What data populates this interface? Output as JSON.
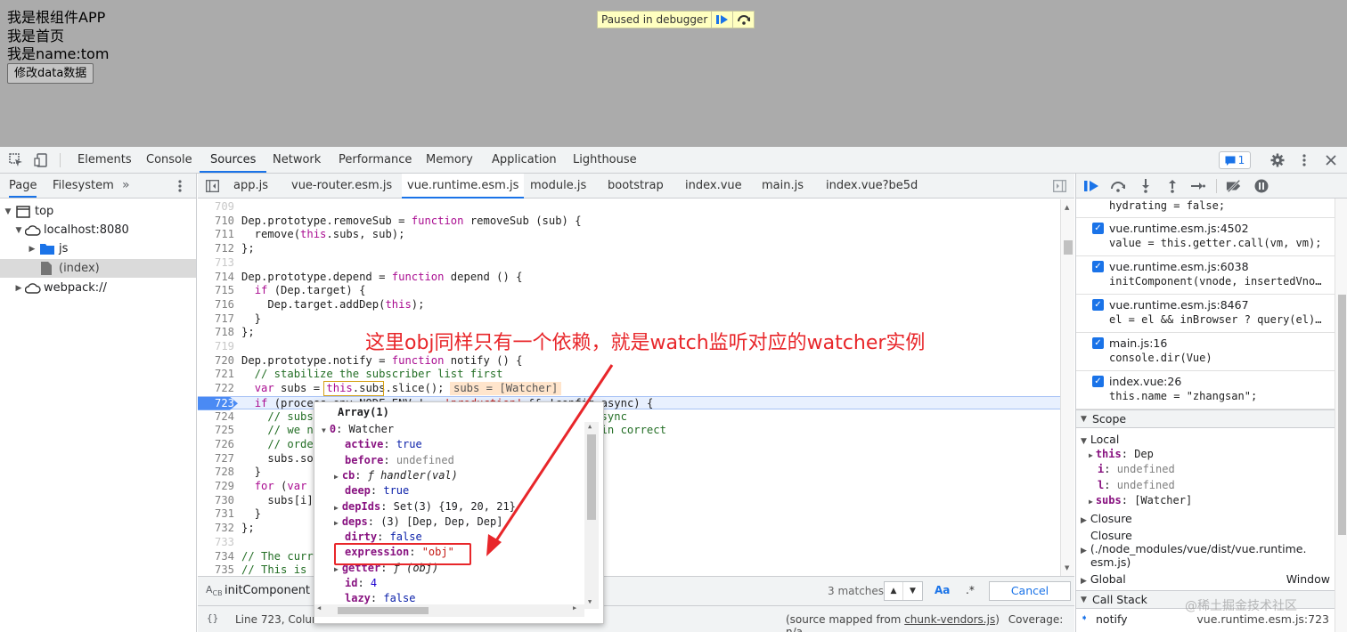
{
  "page": {
    "lines": [
      "我是根组件APP",
      "我是首页",
      "我是name:tom"
    ],
    "button_label": "修改data数据",
    "paused_text": "Paused in debugger"
  },
  "devtools_tabs": [
    "Elements",
    "Console",
    "Sources",
    "Network",
    "Performance",
    "Memory",
    "Application",
    "Lighthouse"
  ],
  "active_tab": "Sources",
  "issues_count": "1",
  "navigator": {
    "tabs": [
      "Page",
      "Filesystem"
    ],
    "tree": [
      {
        "label": "top",
        "depth": 0,
        "icon": "frame-icon",
        "expanded": true
      },
      {
        "label": "localhost:8080",
        "depth": 1,
        "icon": "cloud-icon",
        "expanded": true
      },
      {
        "label": "js",
        "depth": 2,
        "icon": "folder-icon",
        "expanded": false
      },
      {
        "label": "(index)",
        "depth": 2,
        "icon": "file-icon",
        "selected": true
      },
      {
        "label": "webpack://",
        "depth": 0,
        "icon": "cloud-icon",
        "expanded": false
      }
    ]
  },
  "file_tabs": [
    "app.js",
    "vue-router.esm.js",
    "vue.runtime.esm.js",
    "module.js",
    "bootstrap",
    "index.vue",
    "main.js",
    "index.vue?be5d"
  ],
  "active_file": "vue.runtime.esm.js",
  "code_lines": [
    {
      "n": "709",
      "t": ""
    },
    {
      "n": "710",
      "t": "Dep.prototype.removeSub = function removeSub (sub) {"
    },
    {
      "n": "711",
      "t": "  remove(this.subs, sub);"
    },
    {
      "n": "712",
      "t": "};"
    },
    {
      "n": "713",
      "t": ""
    },
    {
      "n": "714",
      "t": "Dep.prototype.depend = function depend () {"
    },
    {
      "n": "715",
      "t": "  if (Dep.target) {"
    },
    {
      "n": "716",
      "t": "    Dep.target.addDep(this);"
    },
    {
      "n": "717",
      "t": "  }"
    },
    {
      "n": "718",
      "t": "};"
    },
    {
      "n": "719",
      "t": ""
    },
    {
      "n": "720",
      "t": "Dep.prototype.notify = function notify () {"
    },
    {
      "n": "721",
      "t": "  // stabilize the subscriber list first"
    },
    {
      "n": "722",
      "t": "  var subs = this.subs.slice();"
    },
    {
      "n": "723",
      "t": "  if (process.env.NODE_ENV !== 'production' && !config.async) {"
    },
    {
      "n": "724",
      "t": "    // subs aren't sorted in scheduler if not running async"
    },
    {
      "n": "725",
      "t": "    // we need to sort them now to make sure they fire in correct"
    },
    {
      "n": "726",
      "t": "    // order"
    },
    {
      "n": "727",
      "t": "    subs.sort(function (a, b) { return a.id - b.id; });"
    },
    {
      "n": "728",
      "t": "  }"
    },
    {
      "n": "729",
      "t": "  for (var i = 0, l = subs.length; i < l; i++) {"
    },
    {
      "n": "730",
      "t": "    subs[i].update();"
    },
    {
      "n": "731",
      "t": "  }"
    },
    {
      "n": "732",
      "t": "};"
    },
    {
      "n": "733",
      "t": ""
    },
    {
      "n": "734",
      "t": "// The current target watcher being evaluated."
    },
    {
      "n": "735",
      "t": "// This is globally unique because only one watcher"
    }
  ],
  "inline_value": "subs = [Watcher]",
  "popover": {
    "title": "Array(1)",
    "rows": [
      {
        "k": "0",
        "v": "Watcher",
        "tri": true,
        "open": true
      },
      {
        "k": "active",
        "v": "true",
        "type": "kw"
      },
      {
        "k": "before",
        "v": "undefined",
        "type": "grey"
      },
      {
        "k": "cb",
        "v": "ƒ handler(val)",
        "tri": true,
        "type": "fn"
      },
      {
        "k": "deep",
        "v": "true",
        "type": "kw"
      },
      {
        "k": "depIds",
        "v": "Set(3) {19, 20, 21}",
        "tri": true
      },
      {
        "k": "deps",
        "v": "(3) [Dep, Dep, Dep]",
        "tri": true
      },
      {
        "k": "dirty",
        "v": "false",
        "type": "kw"
      },
      {
        "k": "expression",
        "v": "\"obj\"",
        "type": "str"
      },
      {
        "k": "getter",
        "v": "ƒ (obj)",
        "tri": true,
        "type": "fn"
      },
      {
        "k": "id",
        "v": "4",
        "type": "num"
      },
      {
        "k": "lazy",
        "v": "false",
        "type": "kw"
      }
    ]
  },
  "search": {
    "value": "initComponent",
    "matches": "3 matches",
    "match_case": "Aa",
    "regex": ".*",
    "cancel": "Cancel"
  },
  "status": {
    "position": "Line 723, Colum",
    "source_mapped_prefix": "(source mapped from ",
    "source_mapped_link": "chunk-vendors.js",
    "source_mapped_suffix": ")",
    "coverage": "Coverage: n/a"
  },
  "breakpoints": [
    {
      "file": "",
      "code": "hydrating = false;"
    },
    {
      "file": "vue.runtime.esm.js:4502",
      "code": "value = this.getter.call(vm, vm);"
    },
    {
      "file": "vue.runtime.esm.js:6038",
      "code": "initComponent(vnode, insertedVno…"
    },
    {
      "file": "vue.runtime.esm.js:8467",
      "code": "el = el && inBrowser ? query(el)…"
    },
    {
      "file": "main.js:16",
      "code": "console.dir(Vue)"
    },
    {
      "file": "index.vue:26",
      "code": "this.name = \"zhangsan\";"
    }
  ],
  "scope": {
    "header": "Scope",
    "local_label": "Local",
    "local_items": [
      {
        "k": "this",
        "v": "Dep",
        "tri": true
      },
      {
        "k": "i",
        "v": "undefined"
      },
      {
        "k": "l",
        "v": "undefined"
      },
      {
        "k": "subs",
        "v": "[Watcher]",
        "tri": true
      }
    ],
    "closure1": "Closure",
    "closure2_title": "Closure",
    "closure2_path1": "(./node_modules/vue/dist/vue.runtime.",
    "closure2_path2": "esm.js)",
    "global_label": "Global",
    "global_value": "Window"
  },
  "call_stack": {
    "header": "Call Stack",
    "frame_name": "notify",
    "frame_location": "vue.runtime.esm.js:723"
  },
  "annotation": "这里obj同样只有一个依赖，就是watch监听对应的watcher实例",
  "watermark": "@稀土掘金技术社区",
  "colors": {
    "accent": "#1a73e8",
    "annotation_red": "#e8262a",
    "page_bg": "#ababab",
    "paused_bg": "#ffffc0"
  }
}
